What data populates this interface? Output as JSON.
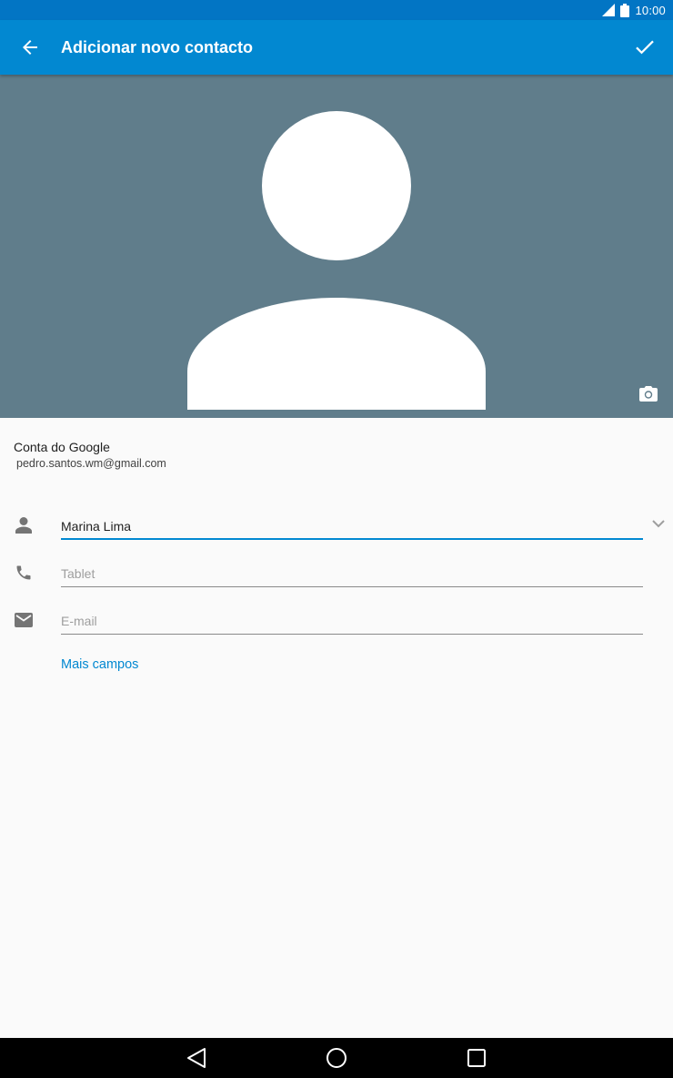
{
  "status_bar": {
    "time": "10:00"
  },
  "app_bar": {
    "title": "Adicionar novo contacto"
  },
  "account": {
    "type": "Conta do Google",
    "email": "pedro.santos.wm@gmail.com"
  },
  "fields": {
    "name": {
      "value": "Marina Lima",
      "placeholder": ""
    },
    "phone": {
      "value": "",
      "placeholder": "Tablet"
    },
    "email": {
      "value": "",
      "placeholder": "E-mail"
    }
  },
  "more_fields_label": "Mais campos",
  "colors": {
    "status_bar": "#0275c4",
    "app_bar": "#0288d1",
    "photo_bg": "#607d8b",
    "accent": "#0288d1",
    "background": "#fafafa"
  },
  "icons": [
    "signal-icon",
    "battery-icon",
    "back-arrow-icon",
    "checkmark-icon",
    "avatar-placeholder",
    "camera-icon",
    "person-icon",
    "phone-icon",
    "mail-icon",
    "chevron-down-icon",
    "nav-back-icon",
    "nav-home-icon",
    "nav-recents-icon"
  ]
}
